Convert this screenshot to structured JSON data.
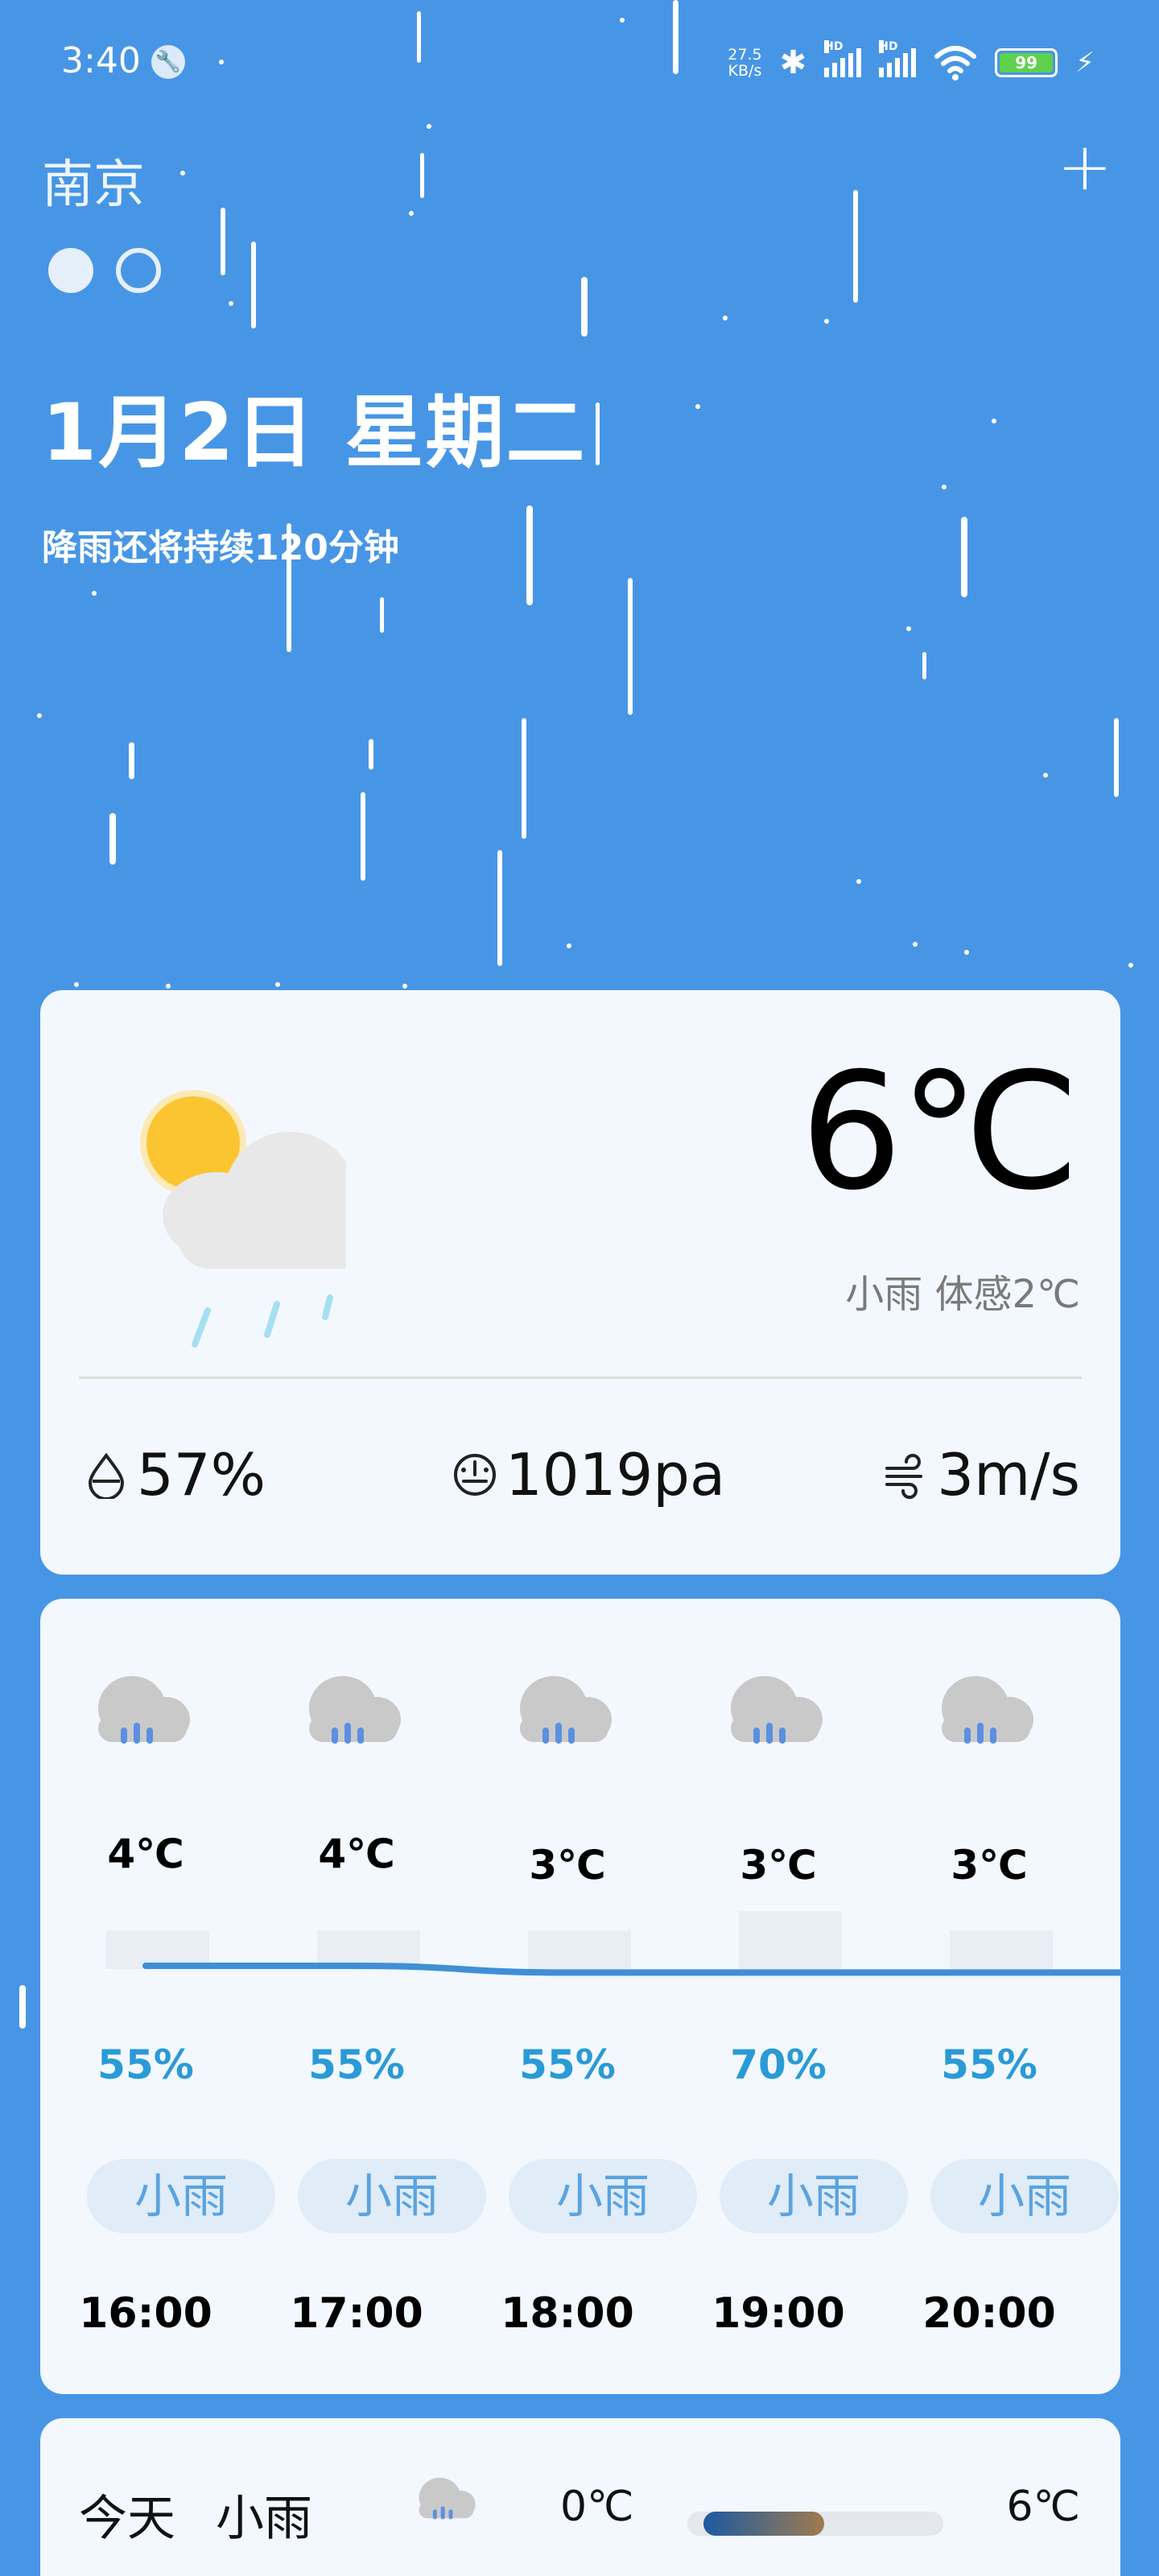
{
  "status_bar": {
    "time": "3:40",
    "net_speed_value": "27.5",
    "net_speed_unit": "KB/s",
    "sim1_label": "HD",
    "sim2_label": "HD",
    "battery": "99"
  },
  "header": {
    "city": "南京",
    "add_label": "+",
    "date": "1月2日 星期二",
    "rain_message": "降雨还将持续120分钟"
  },
  "current": {
    "temperature": "6℃",
    "condition_feels": "小雨 体感2℃",
    "humidity": "57%",
    "pressure": "1019pa",
    "wind": "3m/s"
  },
  "hourly": [
    {
      "temp": "4℃",
      "temp_value": 4,
      "humidity": "55%",
      "condition": "小雨",
      "time": "16:00",
      "icon": "cloud-rain-icon"
    },
    {
      "temp": "4℃",
      "temp_value": 4,
      "humidity": "55%",
      "condition": "小雨",
      "time": "17:00",
      "icon": "cloud-rain-icon"
    },
    {
      "temp": "3℃",
      "temp_value": 3,
      "humidity": "55%",
      "condition": "小雨",
      "time": "18:00",
      "icon": "cloud-rain-icon"
    },
    {
      "temp": "3℃",
      "temp_value": 3,
      "humidity": "70%",
      "condition": "小雨",
      "time": "19:00",
      "icon": "cloud-rain-icon"
    },
    {
      "temp": "3℃",
      "temp_value": 3,
      "humidity": "55%",
      "condition": "小雨",
      "time": "20:00",
      "icon": "cloud-rain-icon"
    }
  ],
  "daily": [
    {
      "day": "今天",
      "condition": "小雨",
      "low": "0℃",
      "high": "6℃",
      "icon": "cloud-rain-icon"
    }
  ],
  "colors": {
    "background": "#4796e6",
    "card": "#f3f8fe",
    "accent": "#2a9ad6",
    "temp_line": "#3f8fd6"
  }
}
